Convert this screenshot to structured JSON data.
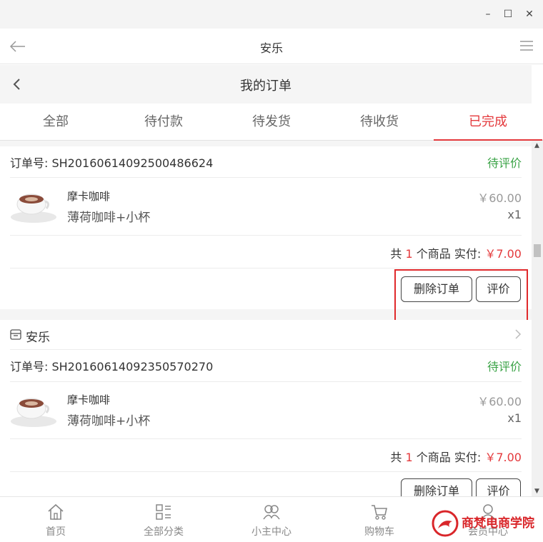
{
  "window": {
    "minimize": "–",
    "maximize": "☐",
    "close": "✕"
  },
  "app": {
    "title": "安乐"
  },
  "page": {
    "title": "我的订单"
  },
  "tabs": [
    {
      "label": "全部"
    },
    {
      "label": "待付款"
    },
    {
      "label": "待发货"
    },
    {
      "label": "待收货"
    },
    {
      "label": "已完成",
      "active": true
    }
  ],
  "orders": [
    {
      "order_no": "订单号: SH20160614092500486624",
      "status": "待评价",
      "item": {
        "name": "摩卡咖啡",
        "spec": "薄荷咖啡+小杯",
        "price": "￥60.00",
        "qty": "x1"
      },
      "summary": {
        "prefix": "共",
        "count": "1",
        "middle": "个商品 实付:",
        "total": "￥7.00"
      },
      "actions": {
        "delete": "删除订单",
        "review": "评价"
      }
    },
    {
      "shop": "安乐",
      "order_no": "订单号: SH20160614092350570270",
      "status": "待评价",
      "item": {
        "name": "摩卡咖啡",
        "spec": "薄荷咖啡+小杯",
        "price": "￥60.00",
        "qty": "x1"
      },
      "summary": {
        "prefix": "共",
        "count": "1",
        "middle": "个商品 实付:",
        "total": "￥7.00"
      },
      "actions": {
        "delete": "删除订单",
        "review": "评价"
      }
    }
  ],
  "bottom_nav": [
    {
      "label": "首页",
      "icon": "home-icon"
    },
    {
      "label": "全部分类",
      "icon": "category-icon"
    },
    {
      "label": "小主中心",
      "icon": "user-center-icon"
    },
    {
      "label": "购物车",
      "icon": "cart-icon"
    },
    {
      "label": "会员中心",
      "icon": "member-icon"
    }
  ],
  "watermark": {
    "text": "商梵电商学院"
  },
  "colors": {
    "accent": "#e4393c",
    "status_green": "#3aa346",
    "highlight": "#e0292b"
  }
}
